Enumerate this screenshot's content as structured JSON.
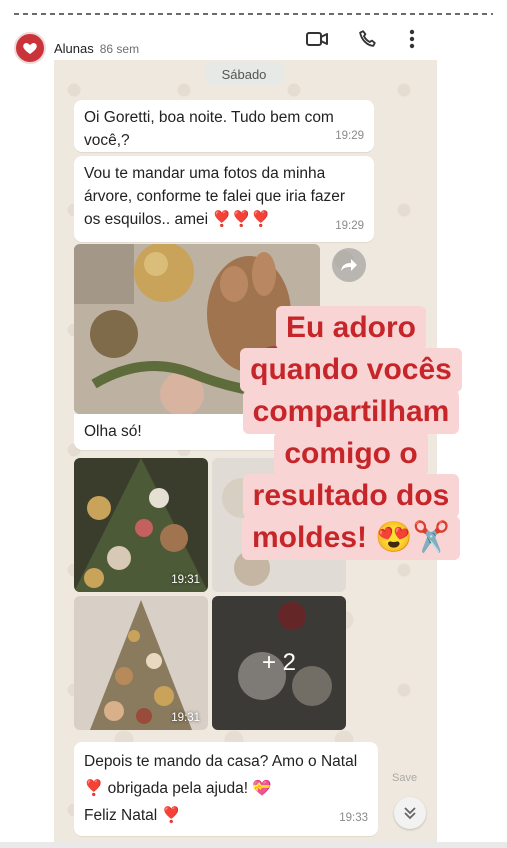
{
  "story": {
    "account_name": "Alunas",
    "time_ago": "86 sem",
    "icons": {
      "video": "video-camera-icon",
      "call": "phone-icon",
      "menu_vertical": "kebab-menu-icon",
      "play": "play-icon",
      "menu_horizontal": "more-options-icon",
      "avatar": "heart-icon"
    }
  },
  "chat": {
    "date_chip": "Sábado",
    "messages": [
      {
        "text": "Oi Goretti, boa noite. Tudo bem com você,?",
        "time": "19:29"
      },
      {
        "text": "Vou te mandar uma fotos da minha árvore, conforme te falei que iria fazer os esquilos.. amei",
        "hearts": "❣️❣️❣️",
        "time": "19:29"
      },
      {
        "text": "Olha só!",
        "time": ""
      },
      {
        "text": "Depois te mando da casa? Amo o Natal",
        "hearts": "❣️",
        "text2": "obrigada pela ajuda!",
        "emoji2": "💝",
        "text3": "Feliz Natal",
        "hearts3": "❣️",
        "time": "19:33"
      }
    ],
    "photo_times": [
      "19:31",
      "19:31"
    ],
    "more_photos": "+ 2"
  },
  "caption": {
    "lines": [
      "Eu adoro",
      "quando vocês",
      "compartilham",
      "comigo o",
      "resultado dos",
      "moldes! 😍✂️"
    ]
  },
  "overlay": {
    "save_label": "Save"
  },
  "colors": {
    "caption_text": "#c6262a",
    "caption_bg": "#f9d4d4",
    "chat_bg": "#efe8de",
    "avatar": "#c9343a"
  }
}
